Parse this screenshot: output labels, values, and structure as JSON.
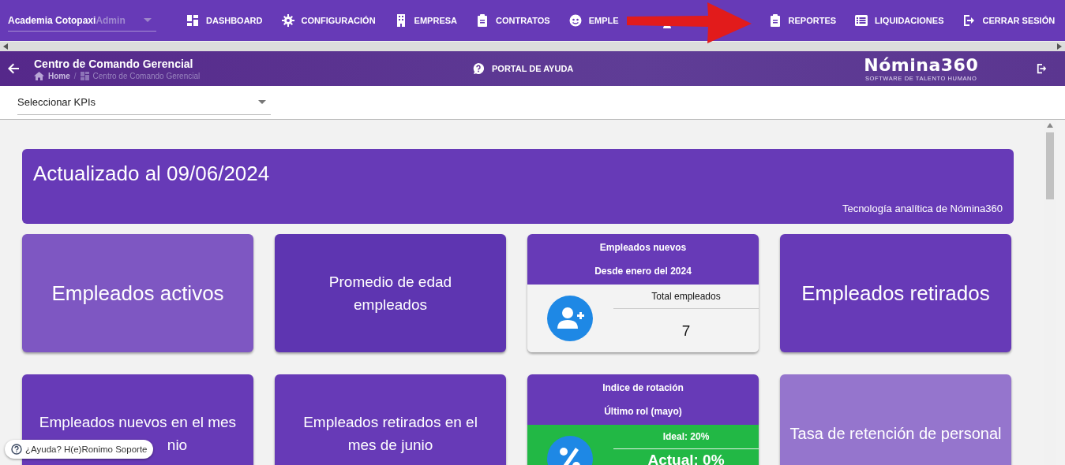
{
  "company_selector": {
    "value": "Academia Cotopaxi",
    "role": "Admin"
  },
  "nav": [
    {
      "label": "DASHBOARD",
      "kind": "grid"
    },
    {
      "label": "CONFIGURACIÓN",
      "kind": "gear"
    },
    {
      "label": "EMPRESA",
      "kind": "building"
    },
    {
      "label": "CONTRATOS",
      "kind": "clipboard"
    },
    {
      "label": "EMPLE",
      "kind": "face"
    },
    {
      "kind": "person"
    },
    {
      "label": "REPORTES",
      "kind": "clipboard"
    },
    {
      "label": "LIQUIDACIONES",
      "kind": "list"
    },
    {
      "label": "CERRAR SESIÓN",
      "kind": "exit"
    }
  ],
  "header": {
    "title": "Centro de Comando Gerencial",
    "breadcrumb": [
      "Home",
      "/",
      "Centro de Comando Gerencial"
    ],
    "help": "PORTAL DE AYUDA",
    "logo": "Nómina360",
    "logo_tagline": "SOFTWARE DE TALENTO HUMANO"
  },
  "kpi_select": {
    "placeholder": "Seleccionar KPIs"
  },
  "banner": {
    "title": "Actualizado al 09/06/2024",
    "note": "Tecnología analítica de Nómina360"
  },
  "cards": [
    {
      "kind": "title",
      "color": "#7e57c2",
      "lines": [
        "Empleados activos"
      ]
    },
    {
      "kind": "title",
      "color": "#5e35b1",
      "lines": [
        "Promedio de edad",
        "empleados"
      ]
    },
    {
      "kind": "user-stat",
      "color": "#f3f3f3",
      "heading": [
        "Empleados nuevos",
        "Desde enero del 2024"
      ],
      "label": "Total empleados",
      "value": "7"
    },
    {
      "kind": "title",
      "color": "#673ab7",
      "lines": [
        "Empleados retirados"
      ]
    },
    {
      "kind": "title",
      "color": "#673ab7",
      "partly_hidden": true,
      "lines": [
        "Empleados nuevos en el mes",
        "nio"
      ]
    },
    {
      "kind": "title",
      "color": "#673ab7",
      "lines": [
        "Empleados retirados en el",
        "mes de junio"
      ]
    },
    {
      "kind": "rate-stat",
      "color": "#22b845",
      "heading": [
        "Indice de rotación",
        "Último rol (mayo)"
      ],
      "label": "Ideal: 20%",
      "value": "Actual: 0%"
    },
    {
      "kind": "title",
      "color": "#9575cd",
      "lines": [
        "Tasa de retención de personal"
      ]
    }
  ],
  "help_chip": {
    "label": "¿Ayuda? H(e)Ronimo Soporte"
  }
}
